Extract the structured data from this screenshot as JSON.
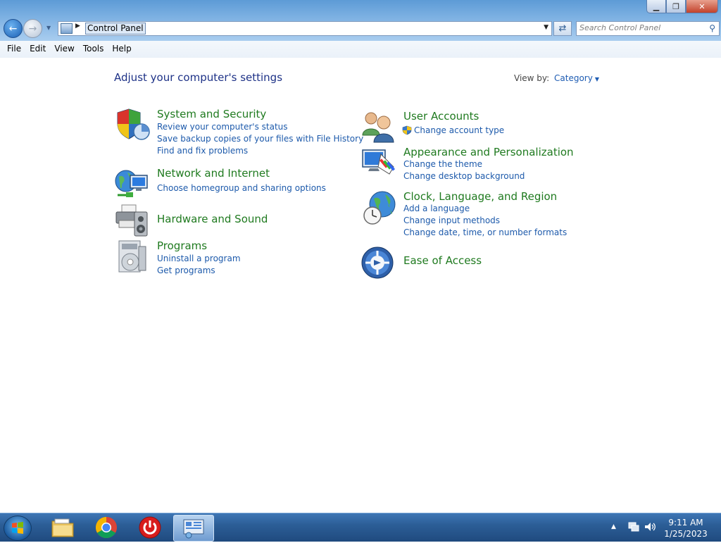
{
  "window": {
    "address": {
      "crumb": "Control Panel"
    },
    "search": {
      "placeholder": "Search Control Panel"
    },
    "controls": {
      "minimize": "▁",
      "maximize": "❐",
      "close": "✕"
    }
  },
  "menu": [
    "File",
    "Edit",
    "View",
    "Tools",
    "Help"
  ],
  "content": {
    "heading": "Adjust your computer's settings",
    "view_by_label": "View by:",
    "view_by_value": "Category",
    "left_categories": [
      {
        "title": "System and Security",
        "icon": "shield-icon",
        "links": [
          "Review your computer's status",
          "Save backup copies of your files with File History",
          "Find and fix problems"
        ]
      },
      {
        "title": "Network and Internet",
        "icon": "network-globe-icon",
        "links": [
          "Choose homegroup and sharing options"
        ]
      },
      {
        "title": "Hardware and Sound",
        "icon": "printer-speaker-icon",
        "links": []
      },
      {
        "title": "Programs",
        "icon": "programs-disc-icon",
        "links": [
          "Uninstall a program",
          "Get programs"
        ]
      }
    ],
    "right_categories": [
      {
        "title": "User Accounts",
        "icon": "users-icon",
        "links": [
          "Change account type"
        ]
      },
      {
        "title": "Appearance and Personalization",
        "icon": "monitor-palette-icon",
        "links": [
          "Change the theme",
          "Change desktop background"
        ]
      },
      {
        "title": "Clock, Language, and Region",
        "icon": "globe-clock-icon",
        "links": [
          "Add a language",
          "Change input methods",
          "Change date, time, or number formats"
        ]
      },
      {
        "title": "Ease of Access",
        "icon": "ease-of-access-icon",
        "links": []
      }
    ]
  },
  "taskbar": {
    "apps": [
      "start-orb-icon",
      "file-explorer-icon",
      "chrome-icon",
      "power-app-icon",
      "control-panel-taskbar-icon"
    ],
    "time": "9:11 AM",
    "date": "1/25/2023"
  }
}
